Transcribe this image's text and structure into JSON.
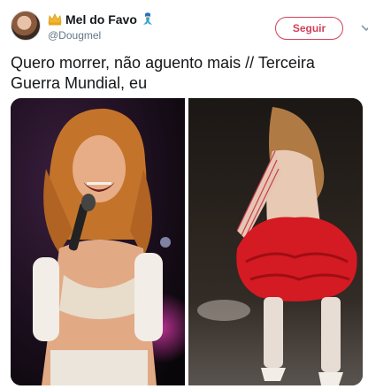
{
  "tweet": {
    "display_name": "Mel do Favo",
    "handle": "@Dougmel",
    "follow_label": "Seguir",
    "text": "Quero morrer, não aguento mais // Terceira Guerra Mundial, eu",
    "media": {
      "photos": [
        {
          "description_icon": "concert-singer-photo"
        },
        {
          "description_icon": "stage-dancer-photo"
        }
      ]
    }
  },
  "colors": {
    "accent": "#d33f5b",
    "text": "#14171a",
    "secondary_text": "#657786"
  }
}
